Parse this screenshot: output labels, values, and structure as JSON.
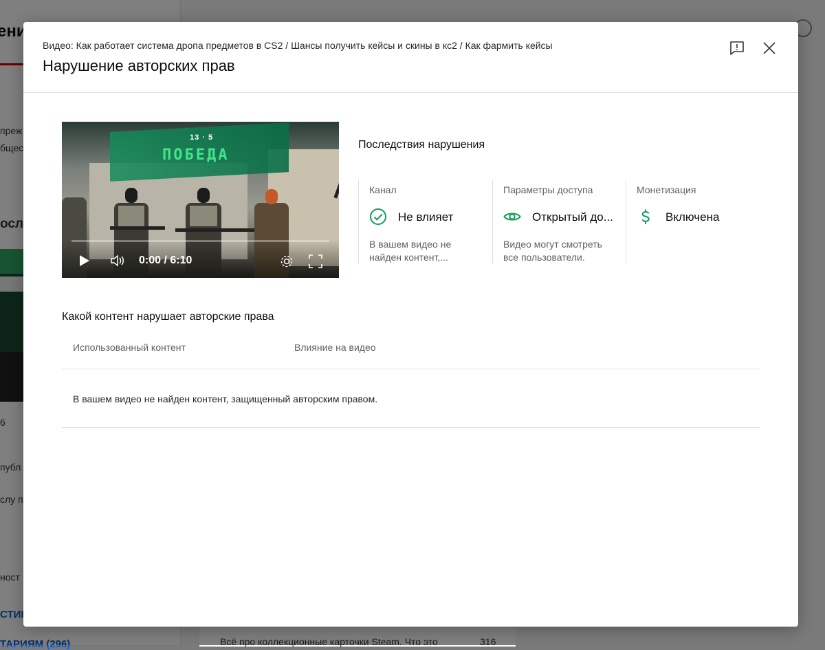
{
  "background": {
    "page_title_fragment": "ени",
    "side_text_1": "преж",
    "side_text_2": "бщест",
    "side_heading": "осл",
    "side_num": "6",
    "side_text_3": "публ",
    "side_text_4": "слу п",
    "side_text_5": "ност",
    "side_link_1": "СТИН",
    "side_link_2": "ТАРИЯМ (296)",
    "bottom_item_text": "Всё про коллекционные карточки Steam. Что это",
    "bottom_item_count": "316"
  },
  "dialog": {
    "video_label": "Видео: Как работает система дропа предметов в CS2 / Шансы получить кейсы и скины в кс2 / Как фармить кейсы",
    "title": "Нарушение авторских прав",
    "feedback_icon": "feedback-icon",
    "close_icon": "close-icon"
  },
  "player": {
    "score": "13 · 5",
    "banner": "ПОБЕДА",
    "time": "0:00 / 6:10",
    "progress": 0
  },
  "consequences": {
    "title": "Последствия нарушения",
    "columns": [
      {
        "heading": "Канал",
        "icon": "check-circle-icon",
        "value": "Не влияет",
        "description": "В вашем видео не найден контент,..."
      },
      {
        "heading": "Параметры доступа",
        "icon": "eye-icon",
        "value": "Открытый до...",
        "description": "Видео могут смотреть все пользователи."
      },
      {
        "heading": "Монетизация",
        "icon": "dollar-icon",
        "value": "Включена",
        "description": ""
      }
    ]
  },
  "content_table": {
    "title": "Какой контент нарушает авторские права",
    "columns": [
      "Использованный контент",
      "Влияние на видео"
    ],
    "empty_message": "В вашем видео не найден контент, защищенный авторским правом."
  },
  "colors": {
    "accent_green": "#0f9d58",
    "text_primary": "#0d0d0d",
    "text_secondary": "#606060"
  }
}
